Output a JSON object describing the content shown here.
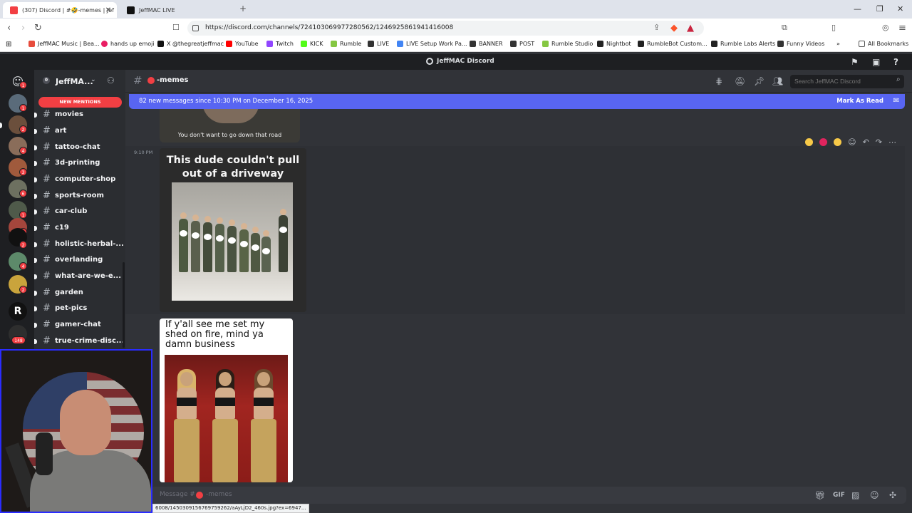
{
  "browser": {
    "tabs": [
      {
        "title": "(307) Discord | #🤣-memes | Jef"
      },
      {
        "title": "JeffMAC LIVE"
      }
    ],
    "url": "https://discord.com/channels/724103069977280562/1246925861941416008",
    "bookmarks": [
      {
        "label": "JeffMAC Music | Bea...",
        "color": "#e74c3c"
      },
      {
        "label": "hands up emoji",
        "color": "#e91e63"
      },
      {
        "label": "X @thegreatjeffmac",
        "color": "#111111"
      },
      {
        "label": "YouTube",
        "color": "#ff0000"
      },
      {
        "label": "Twitch",
        "color": "#9146ff"
      },
      {
        "label": "KICK",
        "color": "#53fc18"
      },
      {
        "label": "Rumble",
        "color": "#85c742"
      },
      {
        "label": "LIVE",
        "color": "#333333"
      },
      {
        "label": "LIVE Setup Work Pa...",
        "color": "#4285f4"
      },
      {
        "label": "BANNER",
        "color": "#333333"
      },
      {
        "label": "POST",
        "color": "#333333"
      },
      {
        "label": "Rumble Studio",
        "color": "#85c742"
      },
      {
        "label": "Nightbot",
        "color": "#222222"
      },
      {
        "label": "RumbleBot Custom...",
        "color": "#222222"
      },
      {
        "label": "Rumble Labs Alerts",
        "color": "#222222"
      },
      {
        "label": "Funny Videos",
        "color": "#333333"
      }
    ],
    "all_bookmarks": "All Bookmarks",
    "status_url": "6008/1450309156769759262/aAyLjD2_460s.jpg?ex=6947..."
  },
  "discord": {
    "window_title": "JeffMAC Discord",
    "server_name": "JeffMA...",
    "new_mentions": "NEW MENTIONS",
    "channels": [
      {
        "name": "movies"
      },
      {
        "name": "art"
      },
      {
        "name": "tattoo-chat"
      },
      {
        "name": "3d-printing"
      },
      {
        "name": "computer-shop"
      },
      {
        "name": "sports-room"
      },
      {
        "name": "car-club"
      },
      {
        "name": "c19"
      },
      {
        "name": "holistic-herbal-..."
      },
      {
        "name": "overlanding"
      },
      {
        "name": "what-are-we-e..."
      },
      {
        "name": "garden"
      },
      {
        "name": "pet-pics"
      },
      {
        "name": "gamer-chat"
      },
      {
        "name": "true-crime-disc..."
      }
    ],
    "server_badges": [
      "1",
      "2",
      "4",
      "3",
      "6",
      "1",
      "4",
      "2",
      "4",
      "2",
      "148"
    ],
    "current_channel": "-memes",
    "search_placeholder": "Search JeffMAC Discord",
    "new_messages_bar": "82 new messages since 10:30 PM on December 16, 2025",
    "mark_as_read": "Mark As Read",
    "prev_caption": "You don't want to go down that road",
    "timestamp": "9:10 PM",
    "meme1_caption": "This dude couldn't pull out of a driveway",
    "meme2_caption": "If y'all see me set my shed on fire, mind ya damn business",
    "composer_placeholder_prefix": "Message #",
    "composer_placeholder_channel": "-memes"
  },
  "colors": {
    "blurple": "#5865f2",
    "mention_red": "#f23f43"
  }
}
